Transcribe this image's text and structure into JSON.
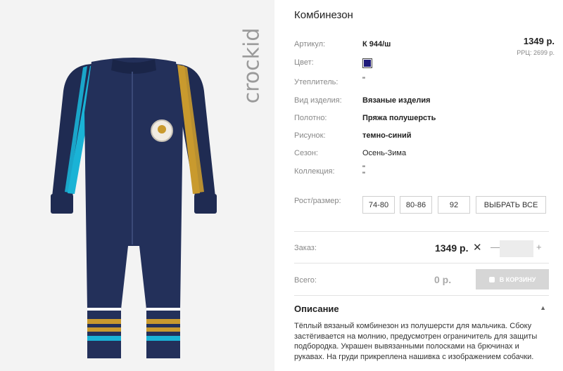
{
  "product": {
    "title": "Комбинезон",
    "brand": "crockid",
    "price": "1349 р.",
    "rrp": "РРЦ: 2699 р."
  },
  "attributes": {
    "article": {
      "label": "Артикул:",
      "value": "К 944/ш"
    },
    "color": {
      "label": "Цвет:",
      "swatch": "#1e1a7a"
    },
    "insulation": {
      "label": "Утеплитель:",
      "value": "\""
    },
    "type": {
      "label": "Вид изделия:",
      "value": "Вязаные изделия"
    },
    "fabric": {
      "label": "Полотно:",
      "value": "Пряжа полушерсть"
    },
    "pattern": {
      "label": "Рисунок:",
      "value": "темно-синий"
    },
    "season": {
      "label": "Сезон:",
      "value": "Осень-Зима"
    },
    "collection": {
      "label": "Коллекция:",
      "value": "\"",
      "value2": "\""
    }
  },
  "sizes": {
    "label": "Рост/размер:",
    "options": [
      "74-80",
      "80-86",
      "92"
    ],
    "select_all": "ВЫБРАТЬ ВСЕ"
  },
  "order": {
    "label": "Заказ:",
    "price": "1349 р.",
    "times": "✕",
    "minus": "—",
    "plus": "+",
    "qty": ""
  },
  "total": {
    "label": "Всего:",
    "value": "0 р.",
    "cart_button": "В КОРЗИНУ"
  },
  "description": {
    "heading": "Описание",
    "text": "Тёплый вязаный комбинезон из полушерсти для мальчика. Сбоку застёгивается на молнию, предусмотрен ограничитель для защиты подбородка. Украшен вывязанными полосками на брючинах и рукавах. На груди прикреплена нашивка с изображением собачки."
  },
  "colors": {
    "navy": "#1f2b52",
    "cyan": "#1ab3d6",
    "mustard": "#c99a2e",
    "button_disabled": "#d6d6d6"
  }
}
